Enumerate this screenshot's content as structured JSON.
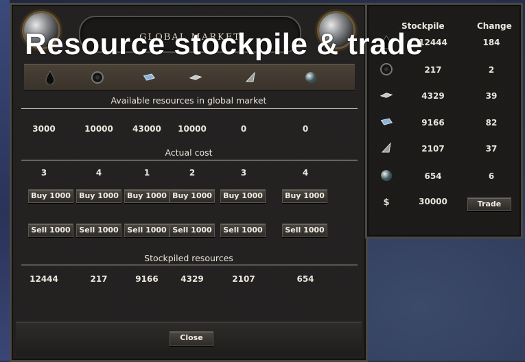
{
  "overlay": {
    "title": "Resource stockpile & trade"
  },
  "market": {
    "title": "GLOBAL MARKET",
    "resources": [
      {
        "icon": "oil-icon"
      },
      {
        "icon": "rubber-icon"
      },
      {
        "icon": "steel-icon"
      },
      {
        "icon": "aluminium-icon"
      },
      {
        "icon": "tungsten-icon"
      },
      {
        "icon": "chromium-icon"
      }
    ],
    "available_label": "Available resources in global market",
    "available": [
      "3000",
      "10000",
      "43000",
      "10000",
      "0",
      "0"
    ],
    "cost_label": "Actual cost",
    "cost": [
      "3",
      "4",
      "1",
      "2",
      "3",
      "4"
    ],
    "buy_label": "Buy 1000",
    "sell_label": "Sell 1000",
    "stockpiled_label": "Stockpiled resources",
    "stockpiled": [
      "12444",
      "217",
      "9166",
      "4329",
      "2107",
      "654"
    ],
    "close_label": "Close"
  },
  "stockpile_panel": {
    "header_stockpile": "Stockpile",
    "header_change": "Change",
    "rows": [
      {
        "icon": "oil-icon",
        "stockpile": "12444",
        "change": "184"
      },
      {
        "icon": "rubber-icon",
        "stockpile": "217",
        "change": "2"
      },
      {
        "icon": "aluminium-icon",
        "stockpile": "4329",
        "change": "39"
      },
      {
        "icon": "steel-icon",
        "stockpile": "9166",
        "change": "82"
      },
      {
        "icon": "tungsten-icon",
        "stockpile": "2107",
        "change": "37"
      },
      {
        "icon": "chromium-icon",
        "stockpile": "654",
        "change": "6"
      }
    ],
    "money_symbol": "$",
    "money": "30000",
    "trade_label": "Trade"
  }
}
